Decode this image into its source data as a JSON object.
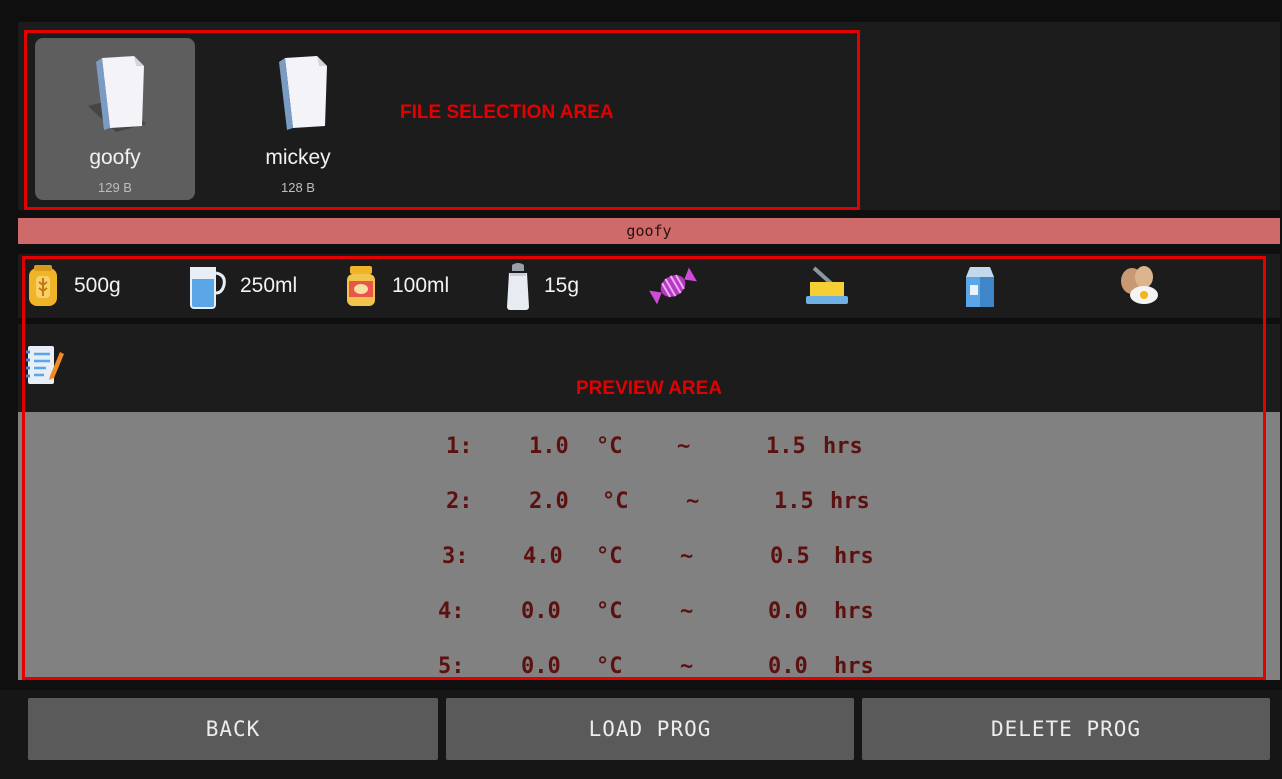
{
  "files": [
    {
      "name": "goofy",
      "size": "129 B",
      "selected": true
    },
    {
      "name": "mickey",
      "size": "128 B",
      "selected": false
    }
  ],
  "annotations": {
    "file_selection": "FILE SELECTION AREA",
    "preview": "PREVIEW AREA"
  },
  "selected_file_bar": "goofy",
  "ingredients": [
    {
      "icon": "flour-sack-icon",
      "value": "500g"
    },
    {
      "icon": "water-jug-icon",
      "value": "250ml"
    },
    {
      "icon": "jar-icon",
      "value": "100ml"
    },
    {
      "icon": "salt-shaker-icon",
      "value": "15g"
    },
    {
      "icon": "candy-icon",
      "value": ""
    },
    {
      "icon": "butter-icon",
      "value": ""
    },
    {
      "icon": "milk-carton-icon",
      "value": ""
    },
    {
      "icon": "eggs-icon",
      "value": ""
    }
  ],
  "notes_icon": "notepad-icon",
  "steps": [
    {
      "num": "1:",
      "temp": "1.0",
      "unit": "°C",
      "sep": "~",
      "time": "1.5",
      "time_unit": "hrs"
    },
    {
      "num": "2:",
      "temp": "2.0",
      "unit": "°C",
      "sep": "~",
      "time": "1.5",
      "time_unit": "hrs"
    },
    {
      "num": "3:",
      "temp": "4.0",
      "unit": "°C",
      "sep": "~",
      "time": "0.5",
      "time_unit": "hrs"
    },
    {
      "num": "4:",
      "temp": "0.0",
      "unit": "°C",
      "sep": "~",
      "time": "0.0",
      "time_unit": "hrs"
    },
    {
      "num": "5:",
      "temp": "0.0",
      "unit": "°C",
      "sep": "~",
      "time": "0.0",
      "time_unit": "hrs"
    }
  ],
  "buttons": {
    "back": "BACK",
    "load": "LOAD PROG",
    "delete": "DELETE PROG"
  },
  "colors": {
    "annotation": "#e30000",
    "file_bar": "#cf6a6a",
    "step_text": "#5c1010",
    "button": "#5a5a5a"
  }
}
